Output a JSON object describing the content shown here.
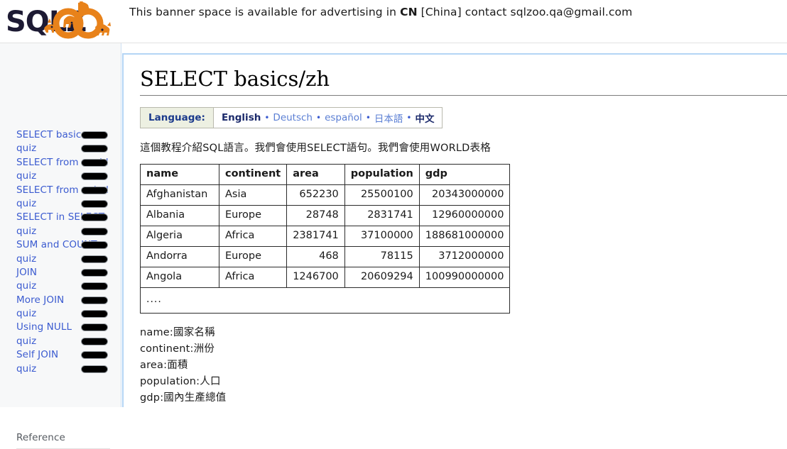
{
  "header": {
    "logo_alt": "SQLZOO",
    "logo_text_dark": "SQLZ",
    "banner_prefix": "This banner space is available for advertising in ",
    "banner_country_code": "CN",
    "banner_middle": " [China] contact ",
    "banner_email": "sqlzoo.qa@gmail.com"
  },
  "sidebar": {
    "items": [
      {
        "label": "SELECT basics",
        "pill": true
      },
      {
        "label": "quiz",
        "pill": true
      },
      {
        "label": "SELECT from world",
        "pill": true
      },
      {
        "label": "quiz",
        "pill": true
      },
      {
        "label": "SELECT from nobel",
        "pill": true
      },
      {
        "label": "quiz",
        "pill": true
      },
      {
        "label": "SELECT in SELECT",
        "pill": true
      },
      {
        "label": "quiz",
        "pill": true
      },
      {
        "label": "SUM and COUNT",
        "pill": true
      },
      {
        "label": "quiz",
        "pill": true
      },
      {
        "label": "JOIN",
        "pill": true
      },
      {
        "label": "quiz",
        "pill": true
      },
      {
        "label": "More JOIN",
        "pill": true
      },
      {
        "label": "quiz",
        "pill": true
      },
      {
        "label": "Using NULL",
        "pill": true
      },
      {
        "label": "quiz",
        "pill": true
      },
      {
        "label": "Self JOIN",
        "pill": true
      },
      {
        "label": "quiz",
        "pill": true
      }
    ],
    "section_heading": "Reference"
  },
  "main": {
    "title": "SELECT basics/zh",
    "language_bar": {
      "label": "Language:",
      "languages": [
        {
          "name": "English",
          "current": true
        },
        {
          "name": "Deutsch",
          "current": false
        },
        {
          "name": "español",
          "current": false
        },
        {
          "name": "日本語",
          "current": false
        },
        {
          "name": "中文",
          "current": true
        }
      ],
      "separator": "•"
    },
    "intro": "這個教程介紹SQL語言。我們會使用SELECT語句。我們會使用WORLD表格",
    "table": {
      "headers": [
        "name",
        "continent",
        "area",
        "population",
        "gdp"
      ],
      "rows": [
        [
          "Afghanistan",
          "Asia",
          "652230",
          "25500100",
          "20343000000"
        ],
        [
          "Albania",
          "Europe",
          "28748",
          "2831741",
          "12960000000"
        ],
        [
          "Algeria",
          "Africa",
          "2381741",
          "37100000",
          "188681000000"
        ],
        [
          "Andorra",
          "Europe",
          "468",
          "78115",
          "3712000000"
        ],
        [
          "Angola",
          "Africa",
          "1246700",
          "20609294",
          "100990000000"
        ]
      ],
      "more_row": "...."
    },
    "definitions": [
      "name:國家名稱",
      "continent:洲份",
      "area:面積",
      "population:人口",
      "gdp:國內生產總值"
    ]
  },
  "colors": {
    "link_blue": "#3b5bd0",
    "content_border_blue": "#b4d5f5",
    "lang_bar_bg": "#edf0e2",
    "logo_orange": "#E8821A",
    "logo_dark": "#1d1a33"
  }
}
